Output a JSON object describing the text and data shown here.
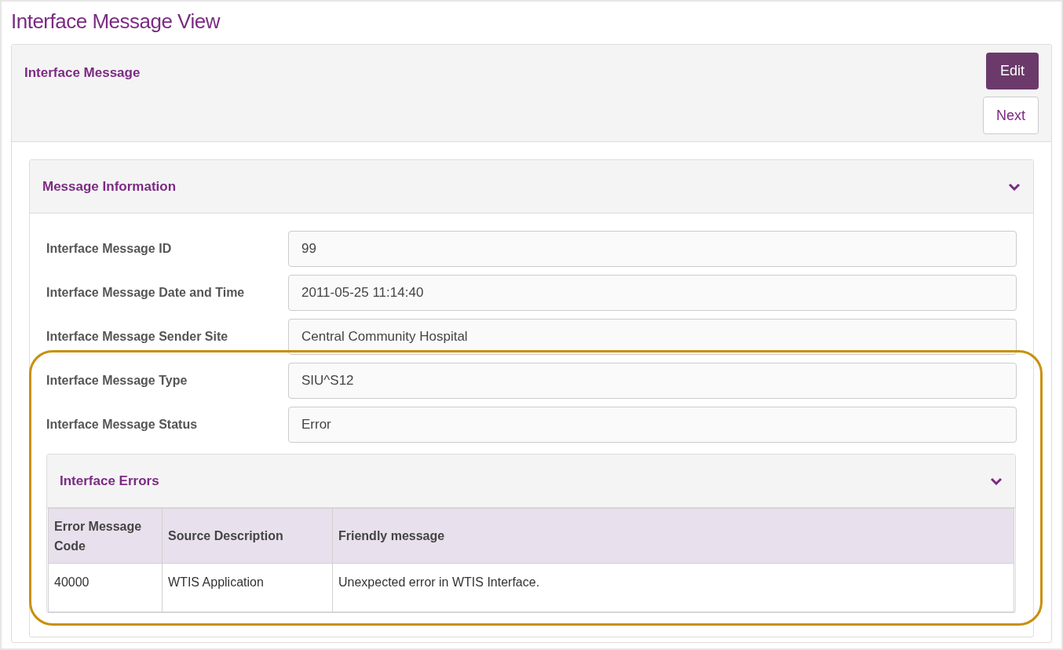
{
  "page_title": "Interface Message View",
  "panel": {
    "title": "Interface Message",
    "buttons": [
      {
        "label": "Edit",
        "kind": "primary"
      },
      {
        "label": "Next",
        "kind": "secondary"
      }
    ]
  },
  "message_information": {
    "title": "Message Information",
    "expanded": true,
    "fields": [
      {
        "label": "Interface Message ID",
        "value": "99"
      },
      {
        "label": "Interface Message Date and Time",
        "value": "2011-05-25 11:14:40"
      },
      {
        "label": "Interface Message Sender Site",
        "value": "Central Community Hospital"
      }
    ],
    "highlighted": {
      "fields": [
        {
          "label": "Interface Message Type",
          "value": "SIU^S12"
        },
        {
          "label": "Interface Message Status",
          "value": "Error"
        }
      ],
      "interface_errors": {
        "title": "Interface Errors",
        "expanded": true,
        "table": {
          "columns": [
            "Error Message Code",
            "Source Description",
            "Friendly message"
          ],
          "rows": [
            [
              "40000",
              "WTIS Application",
              "Unexpected error in WTIS Interface."
            ]
          ]
        }
      }
    }
  }
}
